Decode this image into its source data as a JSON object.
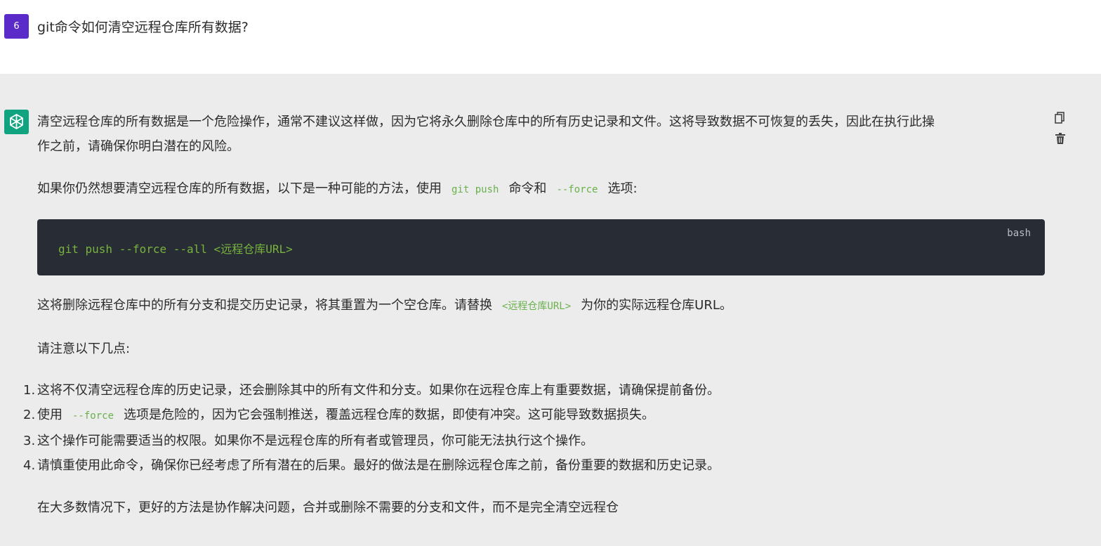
{
  "question": {
    "index": "6",
    "text": "git命令如何清空远程仓库所有数据?"
  },
  "answer": {
    "para1_line1": "清空远程仓库的所有数据是一个危险操作，通常不建议这样做，因为它将永久删除仓库中的所有历史记录和文件。这将导致数据不可恢复的丢失，因此在执行此操",
    "para1_line2": "作之前，请确保你明白潜在的风险。",
    "para2_before": "如果你仍然想要清空远程仓库的所有数据，以下是一种可能的方法，使用",
    "para2_code1": "git push",
    "para2_mid": "命令和",
    "para2_code2": "--force",
    "para2_after": "选项:",
    "codeblock": {
      "lang": "bash",
      "code": "git push --force --all <远程仓库URL>"
    },
    "para3_before": "这将删除远程仓库中的所有分支和提交历史记录，将其重置为一个空仓库。请替换",
    "para3_code": "<远程仓库URL>",
    "para3_after": "为你的实际远程仓库URL。",
    "para4": "请注意以下几点:",
    "list": [
      {
        "num": "1.",
        "text": "这将不仅清空远程仓库的历史记录，还会删除其中的所有文件和分支。如果你在远程仓库上有重要数据，请确保提前备份。"
      },
      {
        "num": "2.",
        "before": "使用",
        "code": "--force",
        "after": "选项是危险的，因为它会强制推送，覆盖远程仓库的数据，即使有冲突。这可能导致数据损失。"
      },
      {
        "num": "3.",
        "text": "这个操作可能需要适当的权限。如果你不是远程仓库的所有者或管理员，你可能无法执行这个操作。"
      },
      {
        "num": "4.",
        "text": "请慎重使用此命令，确保你已经考虑了所有潜在的后果。最好的做法是在删除远程仓库之前，备份重要的数据和历史记录。"
      }
    ],
    "para5": "在大多数情况下，更好的方法是协作解决问题，合并或删除不需要的分支和文件，而不是完全清空远程仓"
  },
  "icons": {
    "copy": "copy-icon",
    "delete": "trash-icon",
    "bot": "chatgpt-logo-icon"
  },
  "colors": {
    "user_badge": "#5a2bc8",
    "bot_badge": "#10a37f",
    "code_bg": "#282c34",
    "code_text": "#78b33e"
  }
}
